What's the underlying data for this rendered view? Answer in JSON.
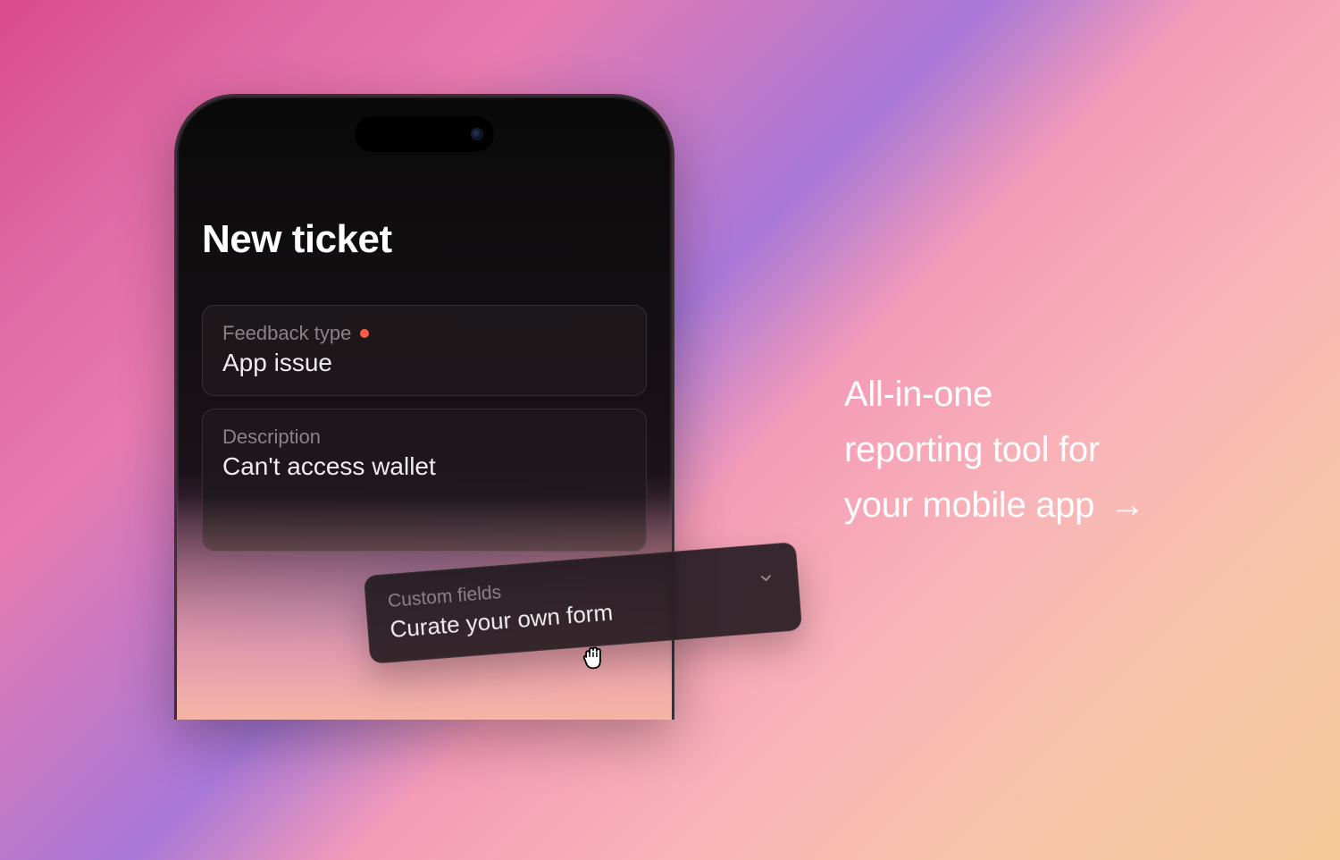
{
  "phone": {
    "title": "New ticket",
    "feedbackType": {
      "label": "Feedback type",
      "value": "App issue",
      "required": true
    },
    "description": {
      "label": "Description",
      "value": "Can't access wallet"
    }
  },
  "floatingCard": {
    "label": "Custom fields",
    "value": "Curate your own form"
  },
  "tagline": {
    "line1": "All-in-one",
    "line2": "reporting tool for",
    "line3": "your mobile app",
    "arrow": "→"
  }
}
